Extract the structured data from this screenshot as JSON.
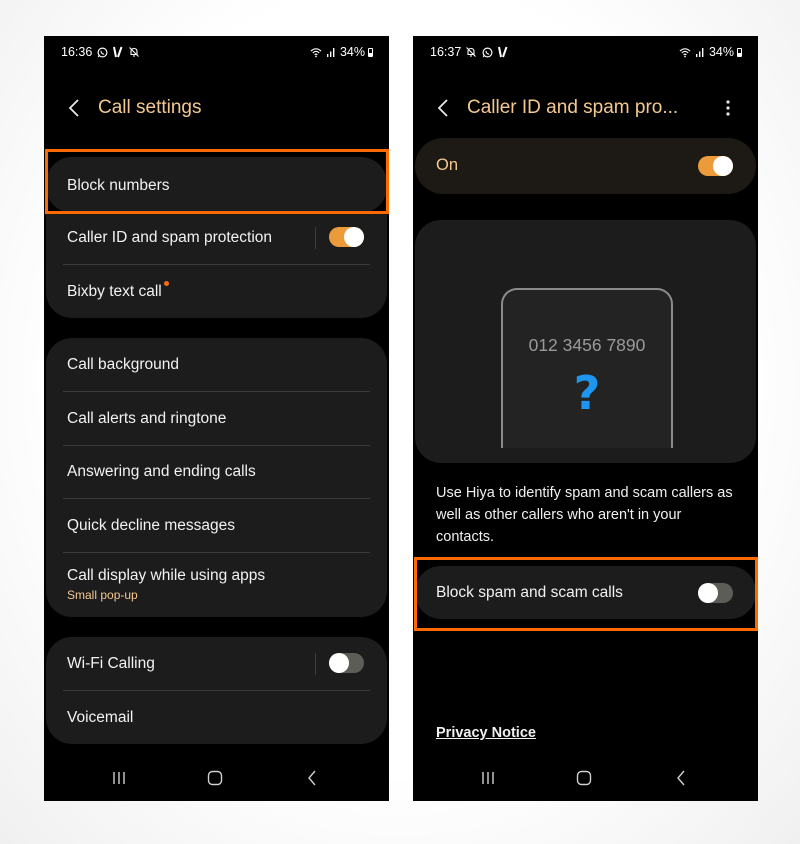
{
  "colors": {
    "accent": "#f4c990",
    "toggle_on": "#eb9b3a",
    "highlight": "#ff6a00",
    "question_mark": "#1e96f0",
    "background": "#000000",
    "card": "#1c1c1c"
  },
  "left_screen": {
    "status_bar": {
      "time": "16:36",
      "left_icons": [
        "whatsapp-icon",
        "v-app-icon",
        "notifications-muted-icon"
      ],
      "right_icons": [
        "wifi-icon",
        "signal-icon",
        "battery-icon"
      ],
      "battery": "34%"
    },
    "header": {
      "back_icon": "chevron-left-icon",
      "title": "Call settings"
    },
    "groups": [
      {
        "items": [
          {
            "label": "Block numbers",
            "highlighted": true
          }
        ]
      },
      {
        "items": [
          {
            "label": "Caller ID and spam protection",
            "toggle": true,
            "toggle_on": true
          },
          {
            "label": "Bixby text call",
            "badge": "new-dot"
          }
        ]
      },
      {
        "items": [
          {
            "label": "Call background"
          },
          {
            "label": "Call alerts and ringtone"
          },
          {
            "label": "Answering and ending calls"
          },
          {
            "label": "Quick decline messages"
          },
          {
            "label": "Call display while using apps",
            "sublabel": "Small pop-up"
          }
        ]
      },
      {
        "items": [
          {
            "label": "Wi-Fi Calling",
            "toggle": true,
            "toggle_on": false
          },
          {
            "label": "Voicemail"
          }
        ]
      }
    ],
    "nav_bar": [
      "recent-apps-icon",
      "home-icon",
      "back-icon"
    ]
  },
  "right_screen": {
    "status_bar": {
      "time": "16:37",
      "left_icons": [
        "notifications-muted-icon",
        "whatsapp-icon",
        "v-app-icon"
      ],
      "right_icons": [
        "wifi-icon",
        "signal-icon",
        "battery-icon"
      ],
      "battery": "34%"
    },
    "header": {
      "back_icon": "chevron-left-icon",
      "title": "Caller ID and spam pro...",
      "more_icon": "more-vertical-icon"
    },
    "master_switch": {
      "label": "On",
      "on": true
    },
    "illustration": {
      "phone_number": "012 3456 7890",
      "symbol": "?"
    },
    "description": "Use Hiya to identify spam and scam callers as well as other callers who aren't in your contacts.",
    "block_spam": {
      "label": "Block spam and scam calls",
      "on": false,
      "highlighted": true
    },
    "privacy_link": "Privacy Notice",
    "nav_bar": [
      "recent-apps-icon",
      "home-icon",
      "back-icon"
    ]
  }
}
